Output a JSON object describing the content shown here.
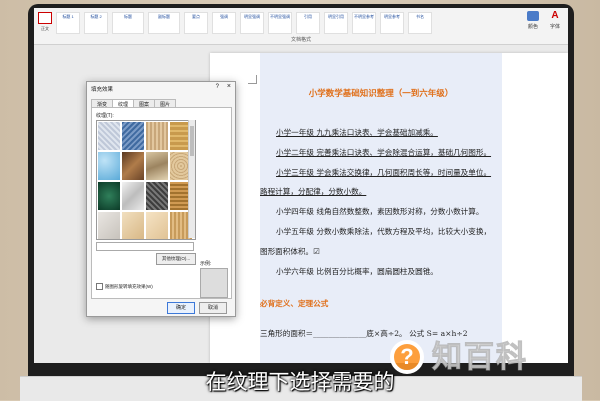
{
  "ribbon": {
    "mini_label": "正文",
    "styles": [
      "标题 1",
      "标题 2",
      "标题",
      "副标题",
      "要点",
      "强调",
      "明显强调",
      "不明显强调",
      "引用",
      "明显引用",
      "不明显参考",
      "明显参考",
      "书名"
    ],
    "right_buttons": [
      "颜色",
      "字体"
    ],
    "group_label": "文档格式"
  },
  "document": {
    "title": "小学数学基础知识整理（一到六年级）",
    "paragraphs": [
      "小学一年级  九九乘法口诀表、学会基础加减乘。",
      "小学二年级  完善乘法口诀表、学会除混合运算，基础几何图形。",
      "小学三年级  学会乘法交换律，几何面积周长等，时间量及单位。",
      "路程计算，分配律，分数小数。",
      "小学四年级  线角自然数整数，素因数形对称，分数小数计算。",
      "小学五年级  分数小数乘除法，代数方程及平均，比较大小变换，",
      "图形面积体积。☑",
      "小学六年级  比例百分比概率，圆扇圆柱及圆锥。",
      "必背定义、定理公式",
      "三角形的面积＝______________底×高÷2。  公式 S= a×h÷2"
    ]
  },
  "dialog": {
    "title": "填充效果",
    "help": "?",
    "close": "×",
    "tabs": [
      "渐变",
      "纹理",
      "图案",
      "图片"
    ],
    "active_tab": "纹理",
    "texture_label": "纹理(T):",
    "more_button": "其他纹理(O)...",
    "sample_label": "示例:",
    "checkbox_label": "随图形旋转填充效果(W)",
    "ok": "确定",
    "cancel": "取消"
  },
  "watermark": {
    "logo_mark": "?",
    "logo_text": "知百科"
  },
  "subtitle": "在纹理下选择需要的",
  "colors": {
    "title_orange": "#e0701b",
    "page_tint": "#e8edf8",
    "logo_orange": "#ff9628"
  }
}
